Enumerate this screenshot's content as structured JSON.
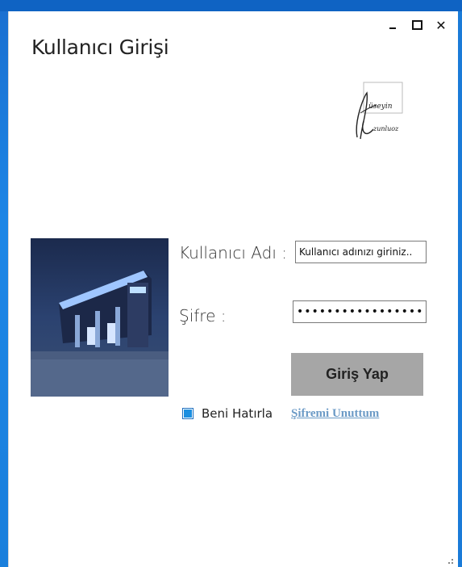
{
  "window": {
    "title": "Kullanıcı Girişi",
    "controls": {
      "close": "✕"
    }
  },
  "logo": {
    "line1": "Hüseyin",
    "line2": "Uzunluoz"
  },
  "form": {
    "username_label": "Kullanıcı Adı :",
    "username_value": "Kullanıcı adınızı giriniz..",
    "password_label": "Şifre :",
    "password_value": "••••••••••••••••••",
    "login_button": "Giriş Yap",
    "remember_label": "Beni Hatırla",
    "remember_checked": true,
    "forgot_link": "Şifremi Unuttum"
  },
  "colors": {
    "desktop": "#1a7fdc",
    "button": "#a6a6a6",
    "link": "#6b9ac6",
    "checkbox": "#1b8fe0"
  }
}
